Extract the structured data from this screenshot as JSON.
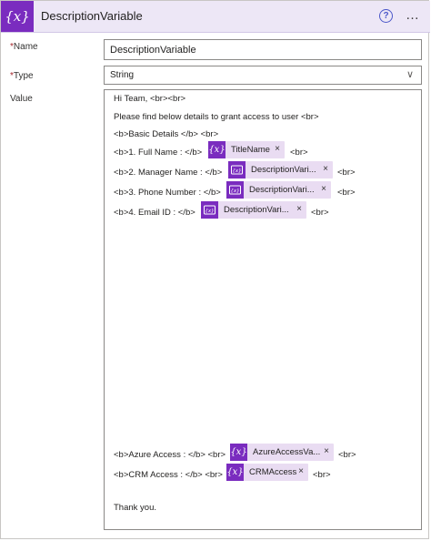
{
  "header": {
    "icon": "{x}",
    "title": "DescriptionVariable",
    "help_icon": "?",
    "more_icon": "…"
  },
  "fields": {
    "name": {
      "required_mark": "*",
      "label": "Name",
      "value": "DescriptionVariable"
    },
    "type": {
      "required_mark": "*",
      "label": "Type",
      "value": "String",
      "chevron": "∨"
    },
    "value": {
      "label": "Value"
    }
  },
  "body": {
    "line1": "Hi Team, <br><br>",
    "line2": "Please find below details to grant access to user <br>",
    "line3": "<b>Basic Details </b> <br>",
    "fullname": {
      "prefix": "<b>1. Full Name : </b>",
      "token": "TitleName",
      "suffix": "<br>"
    },
    "manager": {
      "prefix": "<b>2. Manager Name : </b>",
      "token": "DescriptionVari...",
      "suffix": "<br>"
    },
    "phone": {
      "prefix": "<b>3. Phone Number : </b>",
      "token": "DescriptionVari...",
      "suffix": "<br>"
    },
    "email": {
      "prefix": "<b>4. Email ID : </b>",
      "token": "DescriptionVari...",
      "suffix": "<br>"
    },
    "azure": {
      "prefix": "<b>Azure Access : </b> <br>",
      "token": "AzureAccessVa...",
      "suffix": "<br>"
    },
    "crm": {
      "prefix": "<b>CRM Access : </b> <br>",
      "token": "CRMAccess",
      "suffix": "<br>"
    },
    "closing": "Thank you."
  },
  "icons": {
    "variable": "{x}",
    "compose": "compose-icon",
    "remove": "×"
  },
  "colors": {
    "accent": "#7a2cbf",
    "token_bg": "#e9dcf2",
    "header_bg": "#ede7f6",
    "help": "#4b57c9"
  }
}
